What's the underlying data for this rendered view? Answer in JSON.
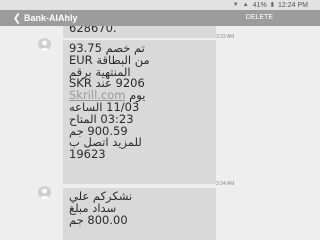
{
  "status_bar": {
    "battery": "41%",
    "time": "12:24 PM"
  },
  "header": {
    "back_icon": "arrow-left-icon",
    "title": "Bank-AlAhly",
    "delete_label": "DELETE"
  },
  "messages": [
    {
      "lines": [
        "628670."
      ],
      "timestamp": "3:33 AM"
    },
    {
      "lines": [
        "تم خصم 93.75",
        "EUR من البطاقة",
        "المنتهية برقم",
        "9206 عند SKR",
        "Skrill.com يوم",
        "11/03 الساعه",
        "03:23 المتاح",
        "900.59 جم",
        "للمزيد اتصل ب",
        "19623"
      ],
      "link": "Skrill.com",
      "timestamp": "3:34 AM"
    },
    {
      "lines": [
        "نشكركم علي",
        "سداد مبلغ",
        "800.00 جم"
      ]
    }
  ],
  "colors": {
    "app_bar": "#9c9c9c",
    "bubble": "#d9d9d9",
    "background": "#eeeeee"
  }
}
